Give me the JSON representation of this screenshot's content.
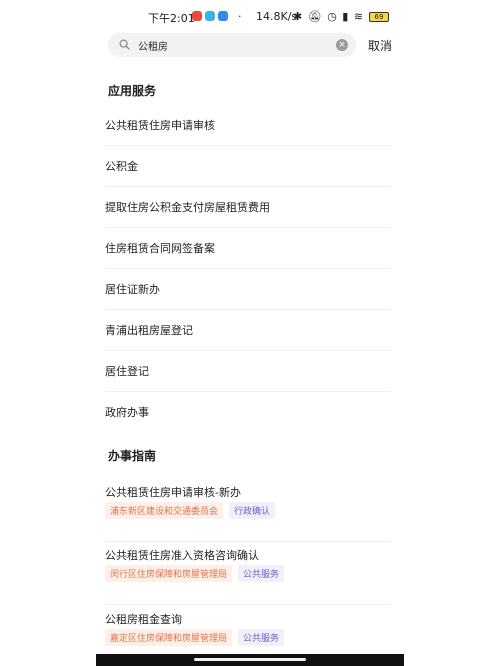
{
  "status_bar": {
    "time": "下午2:01",
    "separator": "·",
    "network_speed": "14.8K/s",
    "battery": "69"
  },
  "search": {
    "query": "公租房",
    "cancel_label": "取消"
  },
  "sections": {
    "services": {
      "title": "应用服务",
      "items": [
        {
          "label": "公共租赁住房申请审核"
        },
        {
          "label": "公积金"
        },
        {
          "label": "提取住房公积金支付房屋租赁费用"
        },
        {
          "label": "住房租赁合同网签备案"
        },
        {
          "label": "居住证新办"
        },
        {
          "label": "青浦出租房屋登记"
        },
        {
          "label": "居住登记"
        },
        {
          "label": "政府办事"
        }
      ]
    },
    "guides": {
      "title": "办事指南",
      "items": [
        {
          "label": "公共租赁住房申请审核-新办",
          "org": "浦东新区建设和交通委员会",
          "type": "行政确认"
        },
        {
          "label": "公共租赁住房准入资格咨询确认",
          "org": "闵行区住房保障和房屋管理局",
          "type": "公共服务"
        },
        {
          "label": "公租房租金查询",
          "org": "嘉定区住房保障和房屋管理局",
          "type": "公共服务"
        }
      ]
    }
  },
  "colors": {
    "org_tag_text": "#e0744a",
    "org_tag_bg": "#fdf0ea",
    "type_tag_text": "#6b62c4",
    "type_tag_bg": "#f0effa",
    "search_bg": "#f1f2f4"
  }
}
